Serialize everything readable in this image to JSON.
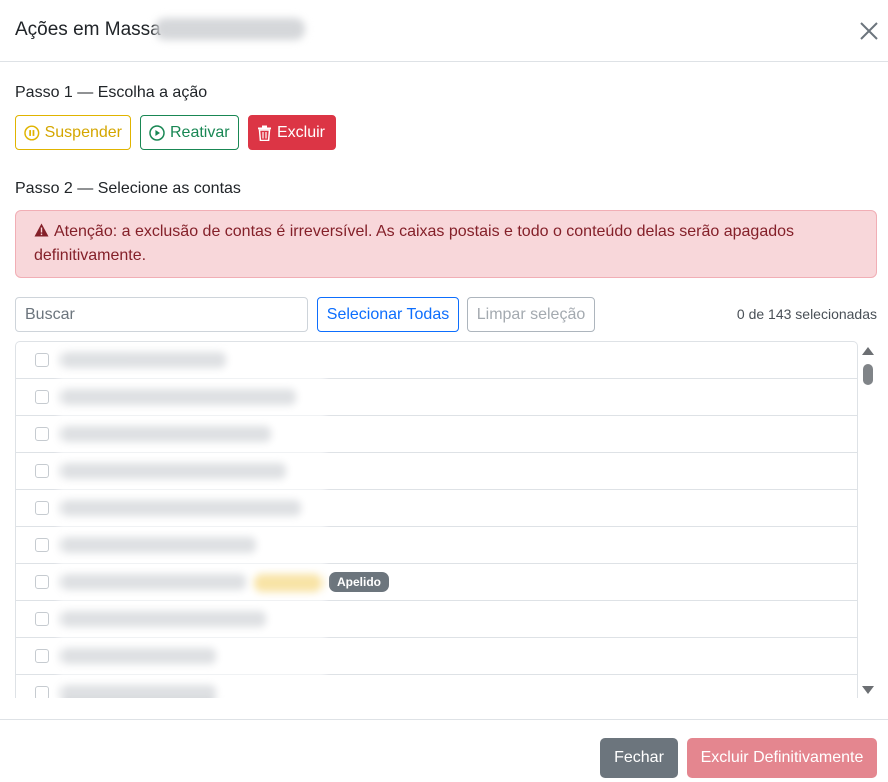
{
  "header": {
    "title": "Ações em Massa"
  },
  "step1": {
    "label": "Passo 1 — Escolha a ação"
  },
  "actions": {
    "suspend": "Suspender",
    "reactivate": "Reativar",
    "delete": "Excluir"
  },
  "step2": {
    "label": "Passo 2 — Selecione as contas"
  },
  "alert": {
    "text": "Atenção: a exclusão de contas é irreversível. As caixas postais e todo o conteúdo delas serão apagados definitivamente."
  },
  "search": {
    "placeholder": "Buscar"
  },
  "select_all": "Selecionar Todas",
  "clear_selection": "Limpar seleção",
  "selection_count": "0 de 143 selecionadas",
  "list": {
    "row_count": 10,
    "alias_badge": "Apelido"
  },
  "footer": {
    "close": "Fechar",
    "delete_permanently": "Excluir Definitivamente"
  },
  "colors": {
    "warning": "#d4a600",
    "success": "#198754",
    "danger": "#dc3545",
    "primary": "#0d6efd",
    "secondary": "#6c757d"
  }
}
